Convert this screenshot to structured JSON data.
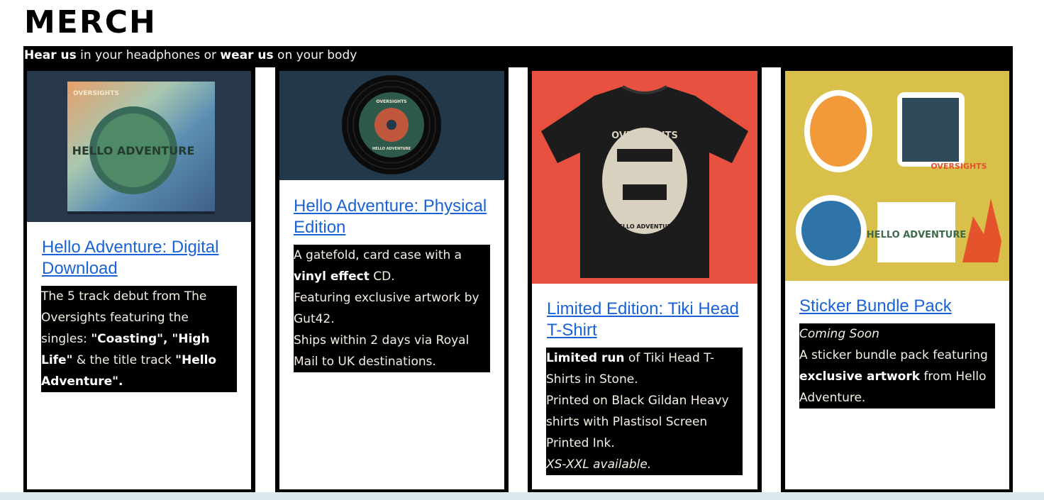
{
  "page": {
    "title": "MERCH",
    "tagline": {
      "bold1": "Hear us",
      "text1": " in your headphones or ",
      "bold2": "wear us",
      "text2": " on your body"
    }
  },
  "cards": [
    {
      "title": "Hello Adventure: Digital Download",
      "image_label": "Hello Adventure album art",
      "art_text": {
        "brand": "OVERSIGHTS",
        "art": "HELLO ADVENTURE"
      },
      "desc": {
        "p1": "The 5 track debut from The Oversights featuring the singles: ",
        "b1": "\"Coasting\", \"High Life\"",
        "p2": " & the title track ",
        "b2": "\"Hello Adventure\"."
      }
    },
    {
      "title": "Hello Adventure: Physical Edition",
      "image_label": "Hello Adventure CD",
      "art_text": {
        "brand": "OVERSIGHTS",
        "art": "HELLO ADVENTURE"
      },
      "desc": {
        "p1": "A gatefold, card case with a ",
        "b1": "vinyl effect",
        "p2": " CD.",
        "line2": "Featuring exclusive artwork by Gut42.",
        "line3": "Ships within 2 days via Royal Mail to UK destinations."
      }
    },
    {
      "title": "Limited Edition: Tiki Head T-Shirt",
      "image_label": "Tiki head t-shirt",
      "art_text": {
        "brand": "OVERSIGHTS",
        "art": "HELLO ADVENTURE"
      },
      "desc": {
        "b1": "Limited run",
        "p1": " of Tiki Head T-Shirts in Stone.",
        "line2": "Printed on Black Gildan Heavy shirts with Plastisol Screen Printed Ink.",
        "italic": "XS-XXL available."
      }
    },
    {
      "title": "Sticker Bundle Pack",
      "image_label": "Sticker bundle",
      "art_text": {
        "brand": "OVERSIGHTS",
        "art": "HELLO ADVENTURE"
      },
      "desc": {
        "italic": "Coming Soon",
        "p1": "A sticker bundle pack featuring ",
        "b1": "exclusive artwork",
        "p2": " from Hello Adventure."
      }
    }
  ],
  "colors": {
    "link": "#1a63d6",
    "section_bg": "#000000",
    "tshirt_bg": "#e8513f",
    "sticker_bg": "#d9c04a",
    "cd_bg": "#233848",
    "album_bg": "#26384a"
  }
}
